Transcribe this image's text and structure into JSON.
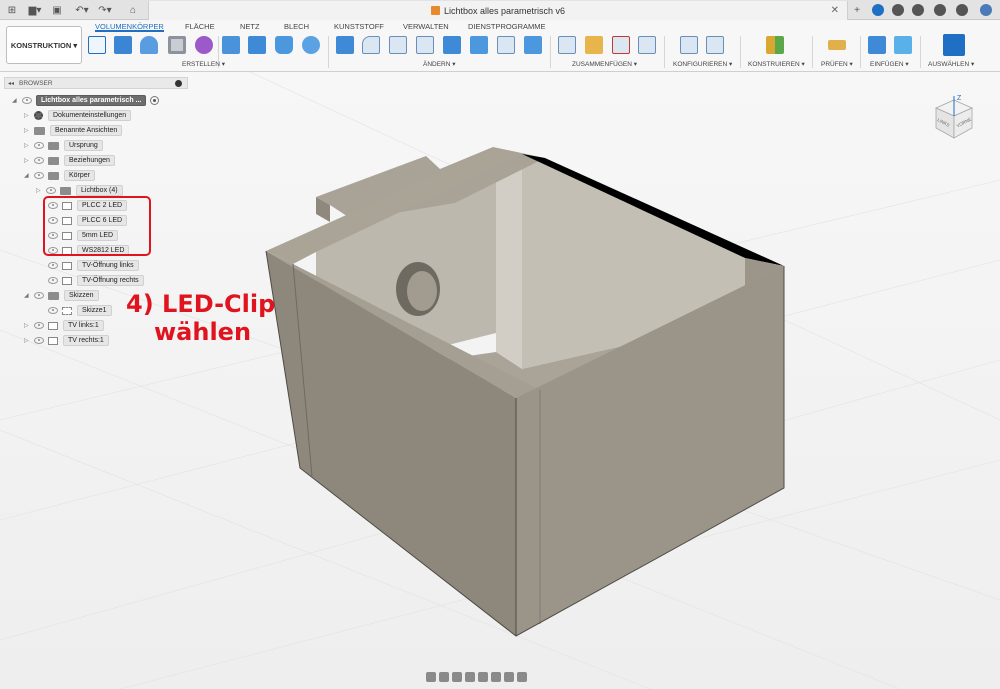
{
  "window": {
    "title": "Lichtbox alles parametrisch v6"
  },
  "toolbar": {
    "workspace": "KONSTRUKTION ▾",
    "tabs": [
      {
        "label": "VOLUMENKÖRPER",
        "active": true
      },
      {
        "label": "FLÄCHE"
      },
      {
        "label": "NETZ"
      },
      {
        "label": "BLECH"
      },
      {
        "label": "KUNSTSTOFF"
      },
      {
        "label": "VERWALTEN"
      },
      {
        "label": "DIENSTPROGRAMME"
      }
    ],
    "groups": [
      {
        "label": "ERSTELLEN ▾"
      },
      {
        "label": "ÄNDERN ▾"
      },
      {
        "label": "ZUSAMMENFÜGEN ▾"
      },
      {
        "label": "KONFIGURIEREN ▾"
      },
      {
        "label": "KONSTRUIEREN ▾"
      },
      {
        "label": "PRÜFEN ▾"
      },
      {
        "label": "EINFÜGEN ▾"
      },
      {
        "label": "AUSWÄHLEN ▾"
      }
    ]
  },
  "browser": {
    "title": "BROWSER",
    "root": "Lichtbox alles parametrisch ...",
    "items": [
      {
        "label": "Dokumenteinstellungen"
      },
      {
        "label": "Benannte Ansichten"
      },
      {
        "label": "Ursprung"
      },
      {
        "label": "Beziehungen"
      },
      {
        "label": "Körper"
      },
      {
        "label": "Lichtbox (4)"
      },
      {
        "label": "PLCC 2 LED"
      },
      {
        "label": "PLCC 6 LED"
      },
      {
        "label": "5mm LED"
      },
      {
        "label": "WS2812 LED"
      },
      {
        "label": "TV-Öffnung links"
      },
      {
        "label": "TV-Öffnung rechts"
      },
      {
        "label": "Skizzen"
      },
      {
        "label": "Skizze1"
      },
      {
        "label": "TV links:1"
      },
      {
        "label": "TV rechts:1"
      }
    ]
  },
  "annotation": {
    "line1": "4) LED-Clip",
    "line2": "wählen"
  },
  "viewcube": {
    "axis": "Z",
    "face_left": "LINKS",
    "face_right": "VORNE"
  },
  "colors": {
    "accent": "#1f6fc5",
    "highlight": "#e0141e",
    "body": "#8e877b"
  }
}
